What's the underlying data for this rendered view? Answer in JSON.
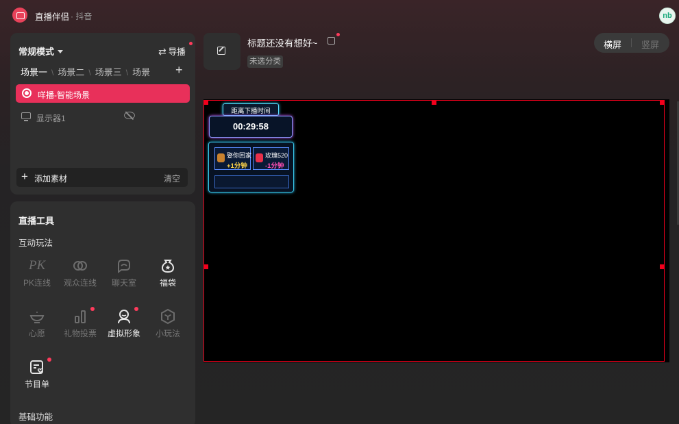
{
  "titlebar": {
    "app_title": "直播伴侣",
    "app_subtitle": "· 抖音",
    "avatar_text": "nb"
  },
  "scene_panel": {
    "mode_label": "常规模式",
    "guide_label": "导播",
    "tabs": [
      {
        "label": "场景一",
        "active": true
      },
      {
        "label": "场景二",
        "active": false
      },
      {
        "label": "场景三",
        "active": false
      },
      {
        "label": "场景",
        "active": false
      }
    ],
    "add_scene_glyph": "+",
    "sources": [
      {
        "label": "咩播-智能场景",
        "selected": true
      },
      {
        "label": "显示器1",
        "selected": false
      }
    ],
    "add_material_label": "添加素材",
    "clear_label": "清空"
  },
  "tools_panel": {
    "title": "直播工具",
    "interactive_heading": "互动玩法",
    "basic_heading": "基础功能",
    "tools": [
      {
        "label": "PK连线",
        "icon": "pk-icon",
        "enabled": false,
        "dot": false
      },
      {
        "label": "观众连线",
        "icon": "link-icon",
        "enabled": false,
        "dot": false
      },
      {
        "label": "聊天室",
        "icon": "chat-icon",
        "enabled": false,
        "dot": false
      },
      {
        "label": "福袋",
        "icon": "lucky-bag-icon",
        "enabled": true,
        "dot": false
      },
      {
        "label": "心愿",
        "icon": "wish-lamp-icon",
        "enabled": false,
        "dot": false
      },
      {
        "label": "礼物投票",
        "icon": "bar-chart-icon",
        "enabled": false,
        "dot": true
      },
      {
        "label": "虚拟形象",
        "icon": "avatar-icon",
        "enabled": true,
        "dot": true
      },
      {
        "label": "小玩法",
        "icon": "cube-icon",
        "enabled": false,
        "dot": false
      },
      {
        "label": "节目单",
        "icon": "program-list-icon",
        "enabled": true,
        "dot": true
      }
    ],
    "pk_glyph": "PK"
  },
  "header": {
    "live_title": "标题还没有想好~",
    "category": "未选分类"
  },
  "orientation": {
    "landscape": "横屏",
    "portrait": "竖屏",
    "selected": "landscape"
  },
  "widget": {
    "banner": "距离下播时间",
    "countdown": "00:29:58",
    "gifts": [
      {
        "name": "娶你回家",
        "value": "+1分钟",
        "value_color": "#ffd54a",
        "icon_color": "#c9822e"
      },
      {
        "name": "玫瑰520",
        "value": "-1分钟",
        "value_color": "#ff4fb3",
        "icon_color": "#e8304a"
      }
    ]
  },
  "colors": {
    "accent": "#e8305a",
    "selection_border": "#f2001c",
    "notification_dot": "#ff3b5c"
  }
}
